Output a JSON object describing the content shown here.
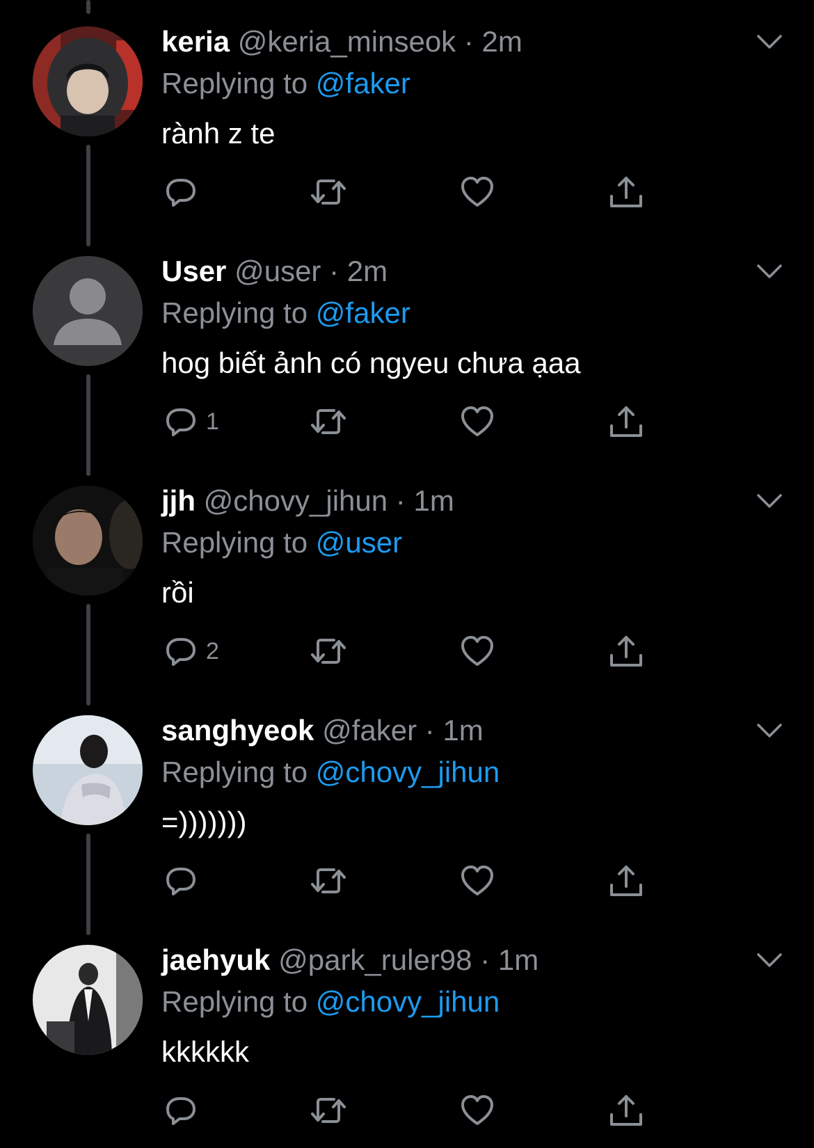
{
  "tweets": [
    {
      "name": "keria",
      "handle": "@keria_minseok",
      "separator": "·",
      "time": "2m",
      "replying_label": "Replying to",
      "replying_to": "@faker",
      "text": "rành z te",
      "reply_count": "",
      "avatar": "photo-hooded-person"
    },
    {
      "name": "User",
      "handle": "@user",
      "separator": "·",
      "time": "2m",
      "replying_label": "Replying to",
      "replying_to": "@faker",
      "text": "hog biết ảnh có ngyeu chưa ạaa",
      "reply_count": "1",
      "avatar": "default-profile-icon"
    },
    {
      "name": "jjh",
      "handle": "@chovy_jihun",
      "separator": "·",
      "time": "1m",
      "replying_label": "Replying to",
      "replying_to": "@user",
      "text": "rồi",
      "reply_count": "2",
      "avatar": "photo-dark-portrait"
    },
    {
      "name": "sanghyeok",
      "handle": "@faker",
      "separator": "·",
      "time": "1m",
      "replying_label": "Replying to",
      "replying_to": "@chovy_jihun",
      "text": "=)))))))",
      "reply_count": "",
      "avatar": "photo-person-sky"
    },
    {
      "name": "jaehyuk",
      "handle": "@park_ruler98",
      "separator": "·",
      "time": "1m",
      "replying_label": "Replying to",
      "replying_to": "@chovy_jihun",
      "text": "kkkkkk",
      "reply_count": "",
      "avatar": "photo-person-suit"
    }
  ],
  "colors": {
    "background": "#000000",
    "text_primary": "#ffffff",
    "text_secondary": "#8b9096",
    "accent": "#1d9bf0",
    "thread_line": "#3d4146"
  },
  "icons": {
    "reply": "reply-icon",
    "retweet": "retweet-icon",
    "like": "heart-icon",
    "share": "share-icon",
    "more": "chevron-down-icon"
  }
}
